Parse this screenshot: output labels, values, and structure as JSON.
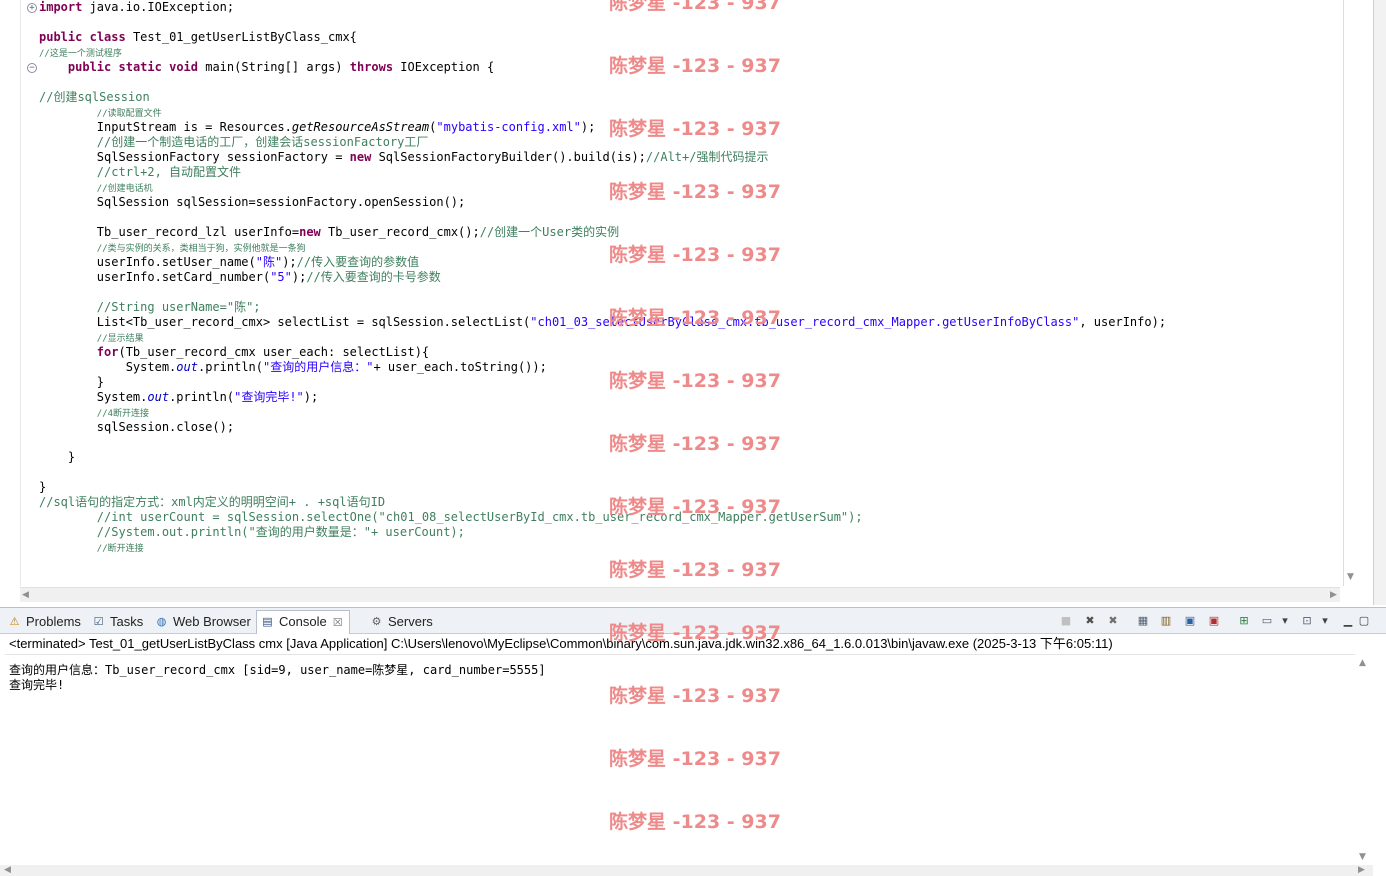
{
  "editor": {
    "lines": [
      {
        "parts": [
          {
            "t": "import",
            "c": "kw"
          },
          {
            "t": " java.io.IOException;"
          }
        ]
      },
      {
        "parts": []
      },
      {
        "parts": [
          {
            "t": "public",
            "c": "kw"
          },
          {
            "t": " "
          },
          {
            "t": "class",
            "c": "kw"
          },
          {
            "t": " Test_01_getUserListByClass_cmx{"
          }
        ]
      },
      {
        "parts": [
          {
            "t": "//这是一个测试程序",
            "c": "cm small"
          }
        ]
      },
      {
        "parts": [
          {
            "t": "    "
          },
          {
            "t": "public",
            "c": "kw"
          },
          {
            "t": " "
          },
          {
            "t": "static",
            "c": "kw"
          },
          {
            "t": " "
          },
          {
            "t": "void",
            "c": "kw"
          },
          {
            "t": " main(String[] args) "
          },
          {
            "t": "throws",
            "c": "kw"
          },
          {
            "t": " IOException {"
          }
        ]
      },
      {
        "parts": []
      },
      {
        "parts": [
          {
            "t": "//创建sqlSession",
            "c": "cm"
          }
        ]
      },
      {
        "parts": [
          {
            "t": "        "
          },
          {
            "t": "//读取配置文件",
            "c": "cm small"
          }
        ]
      },
      {
        "parts": [
          {
            "t": "        InputStream is = Resources."
          },
          {
            "t": "getResourceAsStream",
            "c": "it"
          },
          {
            "t": "("
          },
          {
            "t": "\"mybatis-config.xml\"",
            "c": "str"
          },
          {
            "t": ");"
          }
        ]
      },
      {
        "parts": [
          {
            "t": "        "
          },
          {
            "t": "//创建一个制造电话的工厂，创建会话sessionFactory工厂",
            "c": "cm"
          }
        ]
      },
      {
        "parts": [
          {
            "t": "        SqlSessionFactory sessionFactory = "
          },
          {
            "t": "new",
            "c": "kw"
          },
          {
            "t": " SqlSessionFactoryBuilder().build(is);"
          },
          {
            "t": "//Alt+/强制代码提示",
            "c": "cm"
          }
        ]
      },
      {
        "parts": [
          {
            "t": "        "
          },
          {
            "t": "//ctrl+2, 自动配置文件",
            "c": "cm"
          }
        ]
      },
      {
        "parts": [
          {
            "t": "        "
          },
          {
            "t": "//创建电话机",
            "c": "cm small"
          }
        ]
      },
      {
        "parts": [
          {
            "t": "        SqlSession sqlSession=sessionFactory.openSession();"
          }
        ]
      },
      {
        "parts": []
      },
      {
        "parts": [
          {
            "t": "        Tb_user_record_lzl userInfo="
          },
          {
            "t": "new",
            "c": "kw"
          },
          {
            "t": " Tb_user_record_cmx();"
          },
          {
            "t": "//创建一个User类的实例",
            "c": "cm"
          }
        ]
      },
      {
        "parts": [
          {
            "t": "        "
          },
          {
            "t": "//类与实例的关系，类相当于狗，实例他就是一条狗",
            "c": "cm small"
          }
        ]
      },
      {
        "parts": [
          {
            "t": "        userInfo.setUser_name("
          },
          {
            "t": "\"陈\"",
            "c": "str"
          },
          {
            "t": ");"
          },
          {
            "t": "//传入要查询的参数值",
            "c": "cm"
          }
        ]
      },
      {
        "parts": [
          {
            "t": "        userInfo.setCard_number("
          },
          {
            "t": "\"5\"",
            "c": "str"
          },
          {
            "t": ");"
          },
          {
            "t": "//传入要查询的卡号参数",
            "c": "cm"
          }
        ]
      },
      {
        "parts": []
      },
      {
        "parts": [
          {
            "t": "        "
          },
          {
            "t": "//String userName=\"陈\";",
            "c": "cm"
          }
        ]
      },
      {
        "parts": [
          {
            "t": "        List<Tb_user_record_cmx> selectList = sqlSession.selectList("
          },
          {
            "t": "\"ch01_03_selectUserByClass_cmx.tb_user_record_cmx_Mapper.getUserInfoByClass\"",
            "c": "str"
          },
          {
            "t": ", userInfo);"
          }
        ]
      },
      {
        "parts": [
          {
            "t": "        "
          },
          {
            "t": "//显示结果",
            "c": "cm small"
          }
        ]
      },
      {
        "parts": [
          {
            "t": "        "
          },
          {
            "t": "for",
            "c": "kw"
          },
          {
            "t": "(Tb_user_record_cmx user_each: selectList){"
          }
        ]
      },
      {
        "parts": [
          {
            "t": "            System."
          },
          {
            "t": "out",
            "c": "fld"
          },
          {
            "t": ".println("
          },
          {
            "t": "\"查询的用户信息：\"",
            "c": "str"
          },
          {
            "t": "+ user_each.toString());"
          }
        ]
      },
      {
        "parts": [
          {
            "t": "        }"
          }
        ]
      },
      {
        "parts": [
          {
            "t": "        System."
          },
          {
            "t": "out",
            "c": "fld"
          },
          {
            "t": ".println("
          },
          {
            "t": "\"查询完毕!\"",
            "c": "str"
          },
          {
            "t": ");"
          }
        ]
      },
      {
        "parts": [
          {
            "t": "        "
          },
          {
            "t": "//4断开连接",
            "c": "cm small"
          }
        ]
      },
      {
        "parts": [
          {
            "t": "        sqlSession.close();"
          }
        ]
      },
      {
        "parts": []
      },
      {
        "parts": [
          {
            "t": "    }"
          }
        ]
      },
      {
        "parts": []
      },
      {
        "parts": [
          {
            "t": "}"
          }
        ]
      },
      {
        "parts": [
          {
            "t": "//sql语句的指定方式：xml内定义的明明空间+ . +sql语句ID",
            "c": "cm"
          }
        ]
      },
      {
        "parts": [
          {
            "t": "        "
          },
          {
            "t": "//int userCount = sqlSession.selectOne(\"ch01_08_selectUserById_cmx.tb_user_record_cmx_Mapper.getUserSum\");",
            "c": "cm"
          }
        ]
      },
      {
        "parts": [
          {
            "t": "        "
          },
          {
            "t": "//System.out.println(\"查询的用户数量是：\"+ userCount);",
            "c": "cm"
          }
        ]
      },
      {
        "parts": [
          {
            "t": "        "
          },
          {
            "t": "//断开连接",
            "c": "cm small"
          }
        ]
      }
    ]
  },
  "watermark": {
    "text": "陈梦星 -123 - 937"
  },
  "views": {
    "tabs": [
      {
        "label": "Problems",
        "icon": "problems-icon",
        "glyph": "⚠",
        "color": "#c08000"
      },
      {
        "label": "Tasks",
        "icon": "tasks-icon",
        "glyph": "☑",
        "color": "#406080"
      },
      {
        "label": "Web Browser",
        "icon": "globe-icon",
        "glyph": "◍",
        "color": "#3070b0"
      },
      {
        "label": "Console",
        "icon": "console-icon",
        "glyph": "▤",
        "color": "#305080",
        "close": "☒"
      },
      {
        "label": "Servers",
        "icon": "servers-icon",
        "glyph": "⚙",
        "color": "#606060"
      }
    ],
    "status": "<terminated> Test_01_getUserListByClass cmx [Java Application] C:\\Users\\lenovo\\MyEclipse\\Common\\binary\\com.sun.java.jdk.win32.x86_64_1.6.0.013\\bin\\javaw.exe (2025-3-13 下午6:05:11)",
    "console_lines": [
      "查询的用户信息：Tb_user_record_cmx [sid=9, user_name=陈梦星, card_number=5555]",
      "查询完毕!"
    ],
    "toolbar": [
      {
        "name": "terminate-icon",
        "glyph": "■",
        "color": "#c0c0c0"
      },
      {
        "name": "remove-launch-icon",
        "glyph": "✖",
        "color": "#505050"
      },
      {
        "name": "remove-all-terminated-icon",
        "glyph": "✖",
        "color": "#707070"
      },
      {
        "name": "clear-console-icon",
        "glyph": "▦",
        "color": "#506070"
      },
      {
        "name": "scroll-lock-icon",
        "glyph": "▥",
        "color": "#806020"
      },
      {
        "name": "show-console-on-stdout-icon",
        "glyph": "▣",
        "color": "#3060a0"
      },
      {
        "name": "show-console-on-stderr-icon",
        "glyph": "▣",
        "color": "#b03030"
      },
      {
        "name": "pin-console-icon",
        "glyph": "⊞",
        "color": "#2a8040"
      },
      {
        "name": "display-selected-console-icon",
        "glyph": "▭",
        "color": "#506070"
      },
      {
        "name": "display-console-dropdown-icon",
        "glyph": "▾",
        "color": "#404040"
      },
      {
        "name": "open-console-icon",
        "glyph": "⊡",
        "color": "#506070"
      },
      {
        "name": "open-console-dropdown-icon",
        "glyph": "▾",
        "color": "#404040"
      },
      {
        "name": "minimize-icon",
        "glyph": "▁",
        "color": "#404040"
      },
      {
        "name": "maximize-icon",
        "glyph": "▢",
        "color": "#404040"
      }
    ]
  }
}
